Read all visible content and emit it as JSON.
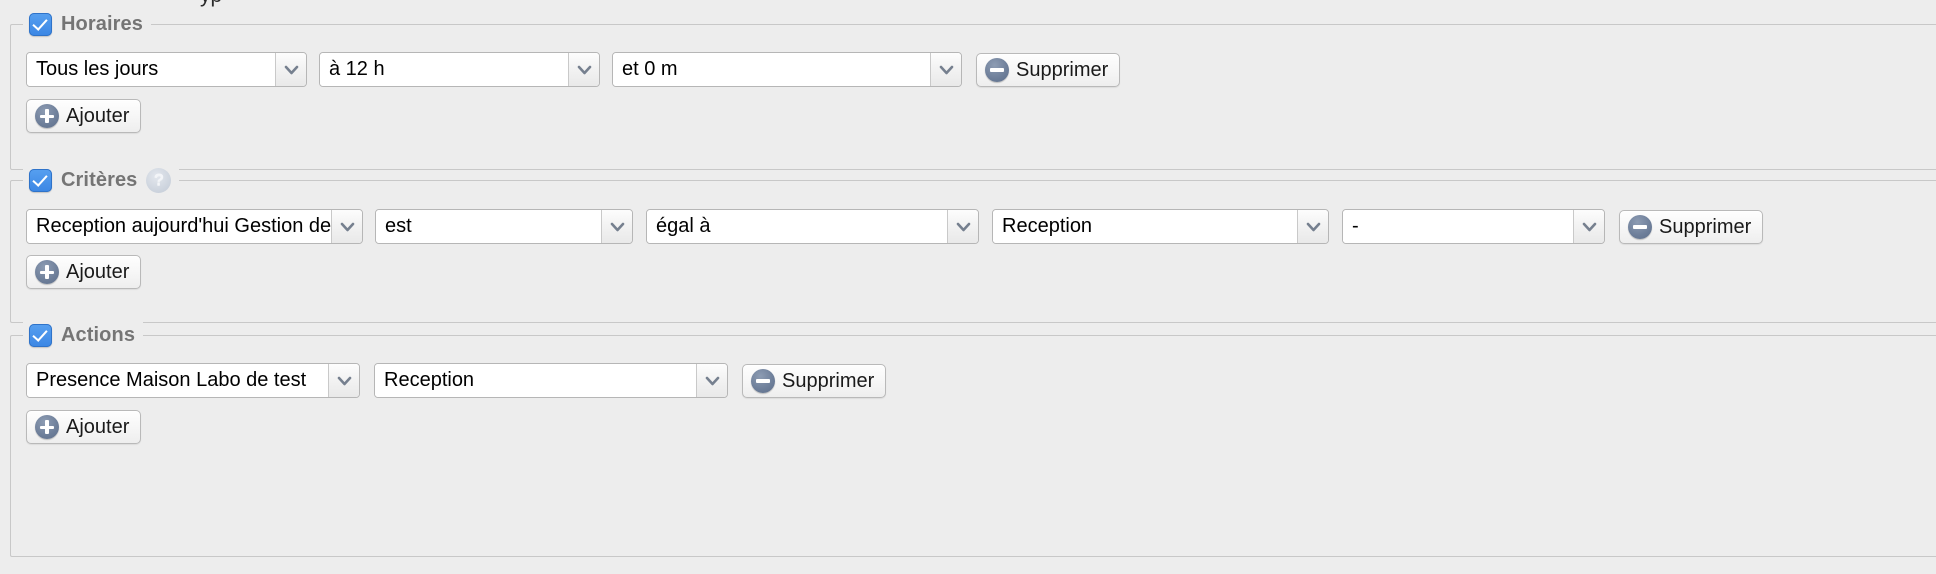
{
  "page": {
    "clipped_top_text": "yp",
    "background_color": "#ededed",
    "accent_color": "#3b86e4",
    "icon_circle_color": "#6d7e99"
  },
  "sections": {
    "horaires": {
      "legend": "Horaires",
      "checked": true,
      "row": {
        "day": {
          "value": "Tous les jours"
        },
        "hour": {
          "value": "à 12 h"
        },
        "minute": {
          "value": "et 0 m"
        },
        "delete_label": "Supprimer"
      },
      "add_label": "Ajouter"
    },
    "criteres": {
      "legend": "Critères",
      "checked": true,
      "help_icon": "?",
      "row": {
        "subject": {
          "value": "Reception aujourd'hui Gestion des "
        },
        "verb": {
          "value": "est"
        },
        "operator": {
          "value": "égal à"
        },
        "value1": {
          "value": "Reception"
        },
        "value2": {
          "value": "-"
        },
        "delete_label": "Supprimer"
      },
      "add_label": "Ajouter"
    },
    "actions": {
      "legend": "Actions",
      "checked": true,
      "row": {
        "target": {
          "value": "Presence Maison Labo de test"
        },
        "action": {
          "value": "Reception"
        },
        "delete_label": "Supprimer"
      },
      "add_label": "Ajouter"
    }
  }
}
